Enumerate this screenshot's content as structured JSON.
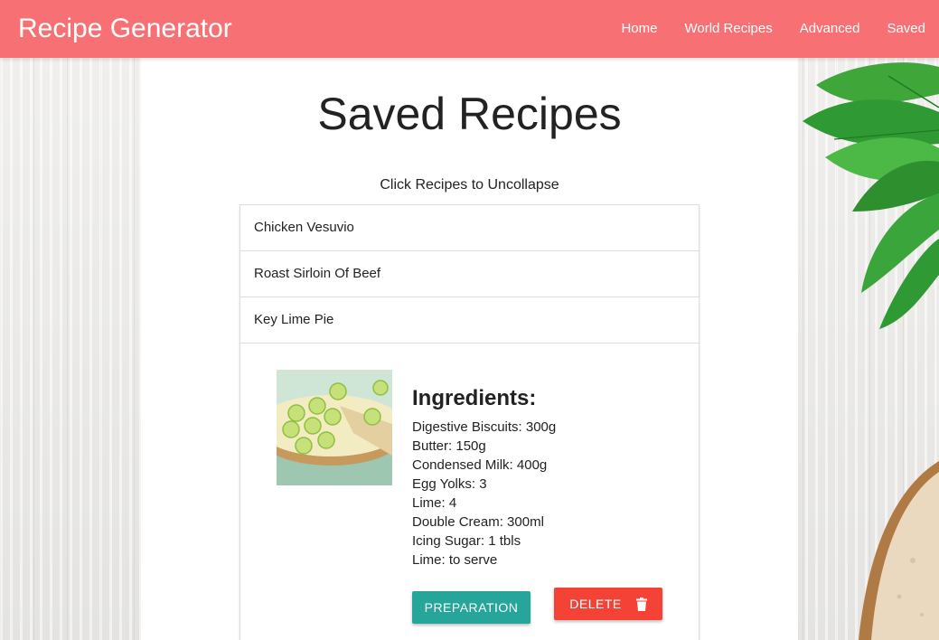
{
  "navbar": {
    "brand": "Recipe Generator",
    "links": [
      "Home",
      "World Recipes",
      "Advanced",
      "Saved"
    ]
  },
  "page": {
    "title": "Saved Recipes",
    "hint": "Click Recipes to Uncollapse"
  },
  "recipes": [
    "Chicken Vesuvio",
    "Roast Sirloin Of Beef",
    "Key Lime Pie"
  ],
  "expanded_recipe": {
    "ingredients_title": "Ingredients:",
    "ingredients": [
      "Digestive Biscuits: 300g",
      "Butter: 150g",
      "Condensed Milk: 400g",
      "Egg Yolks: 3",
      "Lime: 4",
      "Double Cream: 300ml",
      "Icing Sugar: 1 tbls",
      "Lime: to serve"
    ],
    "preparation_label": "Preparation",
    "delete_label": "Delete",
    "delete_icon": "trash-icon"
  },
  "colors": {
    "navbar": "#f77073",
    "preparation_button": "#26a69a",
    "delete_button": "#f44336"
  }
}
